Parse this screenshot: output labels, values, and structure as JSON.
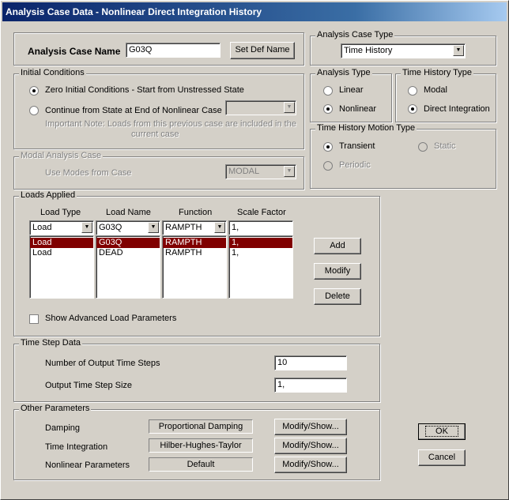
{
  "title": "Analysis Case Data - Nonlinear Direct Integration History",
  "case_name": {
    "label": "Analysis Case Name",
    "value": "G03Q",
    "set_def_button": "Set Def Name"
  },
  "analysis_case_type": {
    "legend": "Analysis Case Type",
    "value": "Time History"
  },
  "initial_conditions": {
    "legend": "Initial Conditions",
    "zero_label": "Zero Initial Conditions - Start from Unstressed State",
    "continue_label": "Continue from State at End of Nonlinear Case",
    "continue_value": "",
    "note_line1": "Important Note:   Loads from this previous case are included in the",
    "note_line2": "current case"
  },
  "analysis_type": {
    "legend": "Analysis Type",
    "linear": "Linear",
    "nonlinear": "Nonlinear"
  },
  "time_history_type": {
    "legend": "Time History Type",
    "modal": "Modal",
    "direct": "Direct Integration"
  },
  "motion_type": {
    "legend": "Time History Motion Type",
    "transient": "Transient",
    "static": "Static",
    "periodic": "Periodic"
  },
  "modal_case": {
    "legend": "Modal Analysis Case",
    "label": "Use Modes from Case",
    "value": "MODAL"
  },
  "loads_applied": {
    "legend": "Loads Applied",
    "headers": [
      "Load Type",
      "Load Name",
      "Function",
      "Scale Factor"
    ],
    "current": [
      "Load",
      "G03Q",
      "RAMPTH",
      "1,"
    ],
    "rows": [
      [
        "Load",
        "G03Q",
        "RAMPTH",
        "1,"
      ],
      [
        "Load",
        "DEAD",
        "RAMPTH",
        "1,"
      ]
    ],
    "add_button": "Add",
    "modify_button": "Modify",
    "delete_button": "Delete",
    "advanced_label": "Show Advanced Load Parameters"
  },
  "time_step": {
    "legend": "Time Step Data",
    "steps_label": "Number of Output Time Steps",
    "steps_value": "10",
    "size_label": "Output Time Step Size",
    "size_value": "1,"
  },
  "other_params": {
    "legend": "Other Parameters",
    "damping_label": "Damping",
    "damping_value": "Proportional Damping",
    "integration_label": "Time Integration",
    "integration_value": "Hilber-Hughes-Taylor",
    "nonlinear_label": "Nonlinear Parameters",
    "nonlinear_value": "Default",
    "modify_show": "Modify/Show..."
  },
  "ok_button": "OK",
  "cancel_button": "Cancel"
}
